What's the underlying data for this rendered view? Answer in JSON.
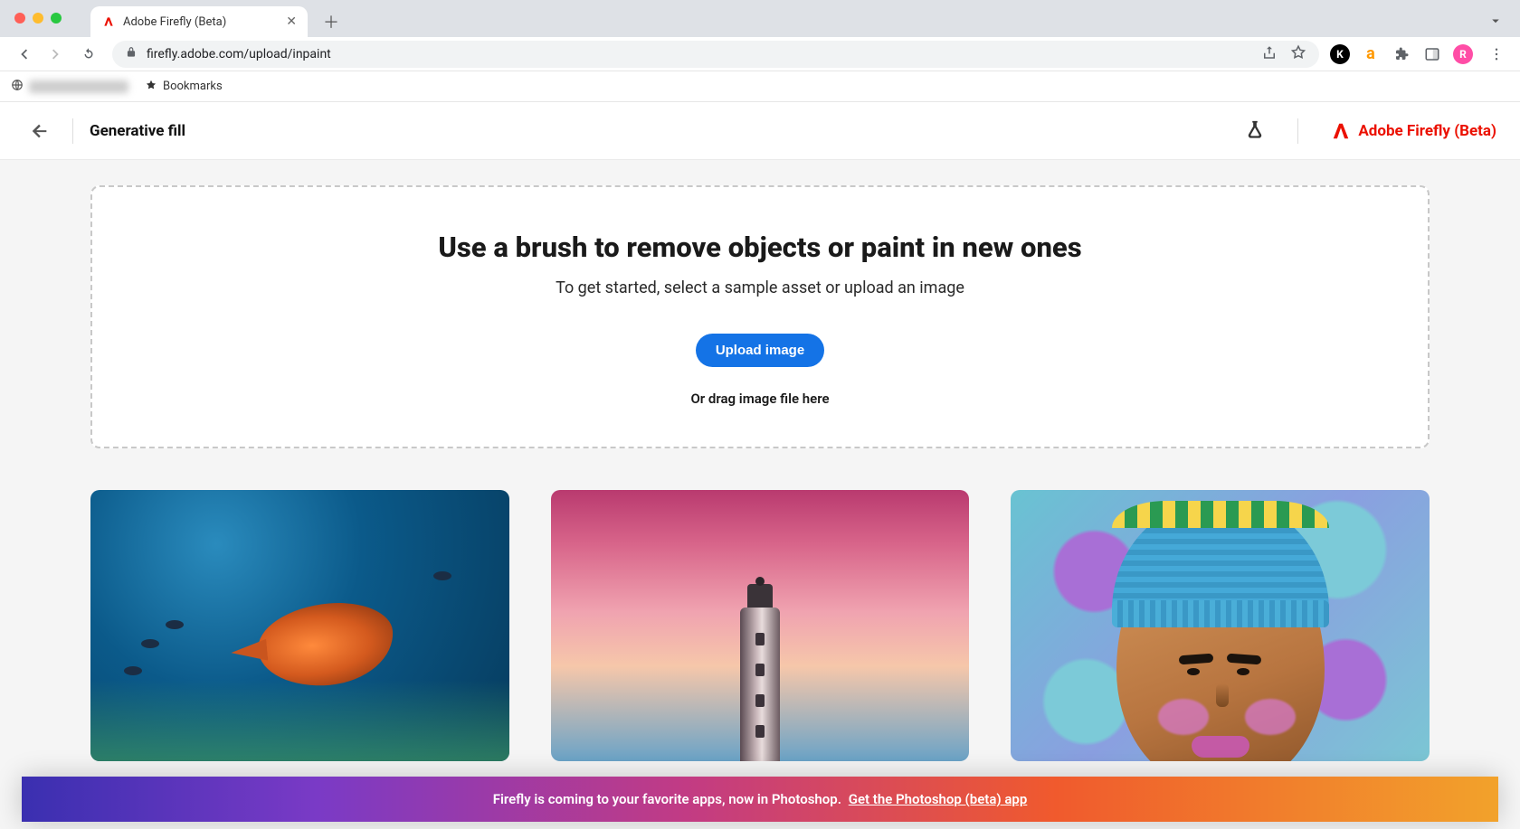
{
  "browser": {
    "tab_title": "Adobe Firefly (Beta)",
    "url": "firefly.adobe.com/upload/inpaint",
    "bookmarks_label": "Bookmarks",
    "avatar_letter": "R"
  },
  "header": {
    "page_title": "Generative fill",
    "brand": "Adobe Firefly (Beta)"
  },
  "dropzone": {
    "heading": "Use a brush to remove objects or paint in new ones",
    "subheading": "To get started, select a sample asset or upload an image",
    "upload_button": "Upload image",
    "drag_hint": "Or drag image file here"
  },
  "samples": [
    {
      "name": "underwater-fish"
    },
    {
      "name": "lighthouse-sunset"
    },
    {
      "name": "stylized-portrait"
    }
  ],
  "banner": {
    "text": "Firefly is coming to your favorite apps, now in Photoshop.",
    "link_text": "Get the Photoshop (beta) app"
  },
  "colors": {
    "accent": "#eb1000",
    "primary_button": "#1473e6"
  }
}
